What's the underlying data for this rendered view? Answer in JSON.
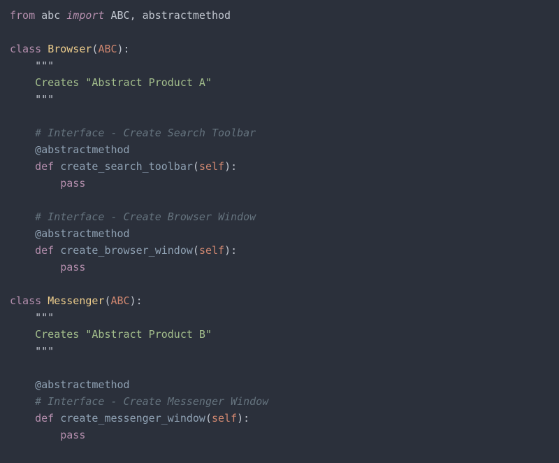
{
  "code": {
    "line1": {
      "from": "from",
      "abc": "abc",
      "import": "import",
      "ABC": "ABC",
      "comma": ",",
      "abstractmethod": "abstractmethod"
    },
    "line3": {
      "class": "class",
      "name": "Browser",
      "lp": "(",
      "base": "ABC",
      "rp": "):"
    },
    "line4": {
      "q": "\"\"\""
    },
    "line5": {
      "txt": "Creates \"Abstract Product A\""
    },
    "line6": {
      "q": "\"\"\""
    },
    "line8": {
      "txt": "# Interface - Create Search Toolbar"
    },
    "line9": {
      "at": "@",
      "dec": "abstractmethod"
    },
    "line10": {
      "def": "def",
      "fn": "create_search_toolbar",
      "lp": "(",
      "self": "self",
      "rp": "):"
    },
    "line11": {
      "pass": "pass"
    },
    "line13": {
      "txt": "# Interface - Create Browser Window"
    },
    "line14": {
      "at": "@",
      "dec": "abstractmethod"
    },
    "line15": {
      "def": "def",
      "fn": "create_browser_window",
      "lp": "(",
      "self": "self",
      "rp": "):"
    },
    "line16": {
      "pass": "pass"
    },
    "line18": {
      "class": "class",
      "name": "Messenger",
      "lp": "(",
      "base": "ABC",
      "rp": "):"
    },
    "line19": {
      "q": "\"\"\""
    },
    "line20": {
      "txt": "Creates \"Abstract Product B\""
    },
    "line21": {
      "q": "\"\"\""
    },
    "line23": {
      "at": "@",
      "dec": "abstractmethod"
    },
    "line24": {
      "txt": "# Interface - Create Messenger Window"
    },
    "line25": {
      "def": "def",
      "fn": "create_messenger_window",
      "lp": "(",
      "self": "self",
      "rp": "):"
    },
    "line26": {
      "pass": "pass"
    }
  }
}
